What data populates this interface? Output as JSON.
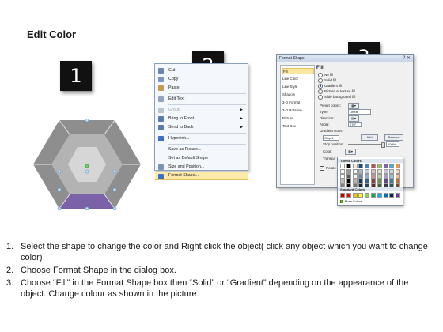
{
  "title": "Edit Color",
  "badges": [
    "1",
    "2",
    "3"
  ],
  "context_menu": {
    "items": [
      {
        "label": "Cut",
        "icon": "scissors-icon",
        "color": "#6c86b4"
      },
      {
        "label": "Copy",
        "icon": "copy-icon",
        "color": "#7d95c0"
      },
      {
        "label": "Paste",
        "icon": "paste-icon",
        "color": "#c49a52"
      },
      {
        "sep": true
      },
      {
        "label": "Edit Text",
        "icon": "edit-text-icon",
        "color": "#8fa5c2"
      },
      {
        "sep": true
      },
      {
        "label": "Group",
        "icon": "group-icon",
        "color": "#b9c3cf",
        "disabled": true,
        "arrow": "▶"
      },
      {
        "label": "Bring to Front",
        "icon": "bring-front-icon",
        "color": "#5a7bb0",
        "arrow": "▶"
      },
      {
        "label": "Send to Back",
        "icon": "send-back-icon",
        "color": "#5a7bb0",
        "arrow": "▶"
      },
      {
        "sep": true
      },
      {
        "label": "Hyperlink...",
        "icon": "hyperlink-icon",
        "color": "#3d6fc4"
      },
      {
        "sep": true
      },
      {
        "label": "Save as Picture...",
        "icon": "",
        "color": ""
      },
      {
        "label": "Set as Default Shape",
        "icon": "",
        "color": ""
      },
      {
        "label": "Size and Position...",
        "icon": "size-icon",
        "color": "#7c93b3"
      },
      {
        "label": "Format Shape...",
        "icon": "format-shape-icon",
        "color": "#3d6fc4",
        "highlight": true
      }
    ]
  },
  "dialog": {
    "title": "Format Shape",
    "window_buttons": "? ✕",
    "categories": [
      "Fill",
      "Line Color",
      "Line Style",
      "Shadow",
      "3-D Format",
      "3-D Rotation",
      "Picture",
      "Text Box"
    ],
    "selected_category": "Fill",
    "section_title": "Fill",
    "fill_options": [
      "No fill",
      "Solid fill",
      "Gradient fill",
      "Picture or texture fill",
      "Slide background fill"
    ],
    "selected_fill": "Gradient fill",
    "preset_label": "Preset colors:",
    "type_label": "Type:",
    "type_value": "Linear",
    "direction_label": "Direction:",
    "angle_label": "Angle:",
    "angle_value": "270°",
    "gradient_stops_label": "Gradient stops",
    "stop_value": "Stop 1",
    "add_label": "Add",
    "remove_label": "Remove",
    "stop_position_label": "Stop position:",
    "stop_position_value": "100%",
    "color_label": "Color:",
    "transparency_label": "Transpa",
    "rotate_label": "Rotate"
  },
  "palette": {
    "theme_header": "Theme Colors",
    "standard_header": "Standard Colors",
    "more_colors": "More Colors...",
    "theme_top": [
      "#ffffff",
      "#000000",
      "#eeece1",
      "#1f497d",
      "#4f81bd",
      "#c0504d",
      "#9bbb59",
      "#8064a2",
      "#4bacc6",
      "#f79646"
    ],
    "standard": [
      "#c00000",
      "#ff0000",
      "#ffc000",
      "#ffff00",
      "#92d050",
      "#00b050",
      "#00b0f0",
      "#0070c0",
      "#002060",
      "#7030a0"
    ]
  },
  "hexagon": {
    "outer_color": "#8e8e8e",
    "middle_color": "#b3b3b3",
    "inner_color": "#d6d6d6",
    "selected_segment_color": "#7b62a8"
  },
  "steps": [
    {
      "num": "1.",
      "text": "Select the shape to change the color and Right click the object( click any object which you want to change color)"
    },
    {
      "num": "2.",
      "text": "Choose Format Shape in the dialog box."
    },
    {
      "num": "3.",
      "text": "Choose “Fill” in the Format Shape box then “Solid” or “Gradient” depending on the appearance of the object. Change colour as shown in the picture."
    }
  ]
}
